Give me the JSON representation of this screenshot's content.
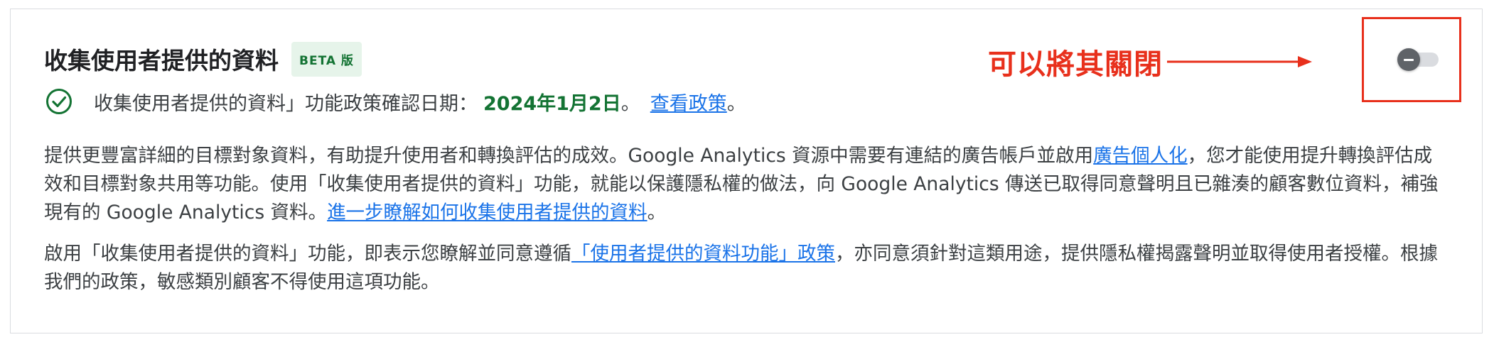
{
  "header": {
    "title": "收集使用者提供的資料",
    "badge": "BETA 版"
  },
  "confirmation": {
    "text": "收集使用者提供的資料」功能政策確認日期：",
    "date": "2024年1月2日",
    "separator": "。",
    "policy_link": "查看政策",
    "end": "。"
  },
  "description": {
    "p1_a": "提供更豐富詳細的目標對象資料，有助提升使用者和轉換評估的成效。Google Analytics 資源中需要有連結的廣告帳戶並啟用",
    "p1_link1": "廣告個人化",
    "p1_b": "，您才能使用提升轉換評估成效和目標對象共用等功能。使用「收集使用者提供的資料」功能，就能以保護隱私權的做法，向 Google Analytics 傳送已取得同意聲明且已雜湊的顧客數位資料，補強現有的 Google Analytics 資料。",
    "p1_link2": "進一步瞭解如何收集使用者提供的資料",
    "p1_c": "。",
    "p2_a": "啟用「收集使用者提供的資料」功能，即表示您瞭解並同意遵循",
    "p2_link": "「使用者提供的資料功能」政策",
    "p2_b": "，亦同意須針對這類用途，提供隱私權揭露聲明並取得使用者授權。根據我們的政策，敏感類別顧客不得使用這項功能。"
  },
  "annotation": {
    "text": "可以將其關閉",
    "color": "#e8301c"
  },
  "toggle": {
    "state": "off"
  },
  "colors": {
    "accent_green": "#137333",
    "link_blue": "#1a73e8",
    "annotation_red": "#e8301c"
  },
  "icons": {
    "confirm": "check-circle-icon",
    "arrow": "arrow-right-icon"
  }
}
